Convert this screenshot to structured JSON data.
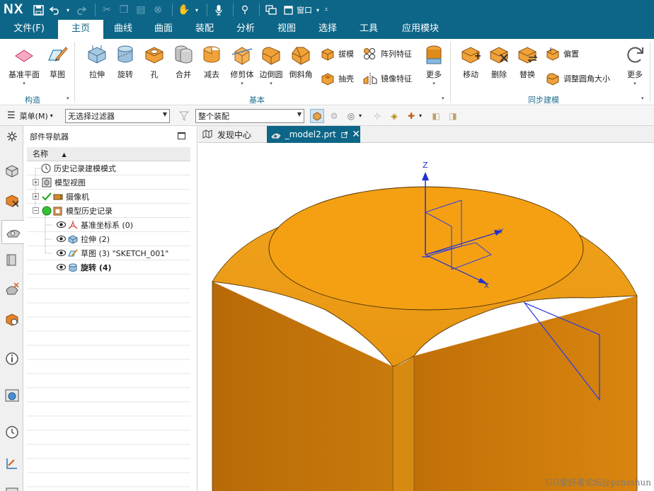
{
  "app": {
    "logo": "NX"
  },
  "quick_access": {
    "window_label": "窗口"
  },
  "menu": {
    "items": [
      "文件(F)",
      "主页",
      "曲线",
      "曲面",
      "装配",
      "分析",
      "视图",
      "选择",
      "工具",
      "应用模块"
    ],
    "active": "主页"
  },
  "ribbon": {
    "construct": {
      "datum_plane": "基准平面",
      "sketch": "草图",
      "group_label": "构造"
    },
    "basic": {
      "extrude": "拉伸",
      "revolve": "旋转",
      "hole": "孔",
      "unite": "合并",
      "subtract": "减去",
      "trim_body": "修剪体",
      "edge_blend": "边倒圆",
      "chamfer": "倒斜角",
      "draft": "拔模",
      "shell": "抽壳",
      "pattern_feature": "阵列特征",
      "mirror_feature": "镜像特征",
      "more": "更多",
      "group_label": "基本"
    },
    "sync": {
      "move": "移动",
      "delete": "删除",
      "replace": "替换",
      "offset": "偏置",
      "resize_blend": "调整圆角大小",
      "more": "更多",
      "group_label": "同步建模"
    }
  },
  "selection_bar": {
    "menu_label": "菜单(M)",
    "filter": "无选择过滤器",
    "scope": "整个装配"
  },
  "navigator": {
    "title": "部件导航器",
    "column": "名称",
    "rows": [
      {
        "label": "历史记录建模模式"
      },
      {
        "label": "模型视图"
      },
      {
        "label": "摄像机"
      },
      {
        "label": "模型历史记录"
      },
      {
        "label": "基准坐标系 (0)"
      },
      {
        "label": "拉伸 (2)"
      },
      {
        "label": "草图 (3) \"SKETCH_001\""
      },
      {
        "label": "旋转 (4)"
      }
    ]
  },
  "tabs": [
    {
      "label": "发现中心"
    },
    {
      "label": "_model2.prt"
    }
  ],
  "viewport": {
    "axis_z": "Z",
    "axis_y": "Y",
    "axis_x": "X",
    "watermark": "UG爱好者论坛@pzhzshun"
  },
  "colors": {
    "title_bg": "#0d6687",
    "body": "#f19a0a",
    "accent": "#1f6f8f"
  }
}
